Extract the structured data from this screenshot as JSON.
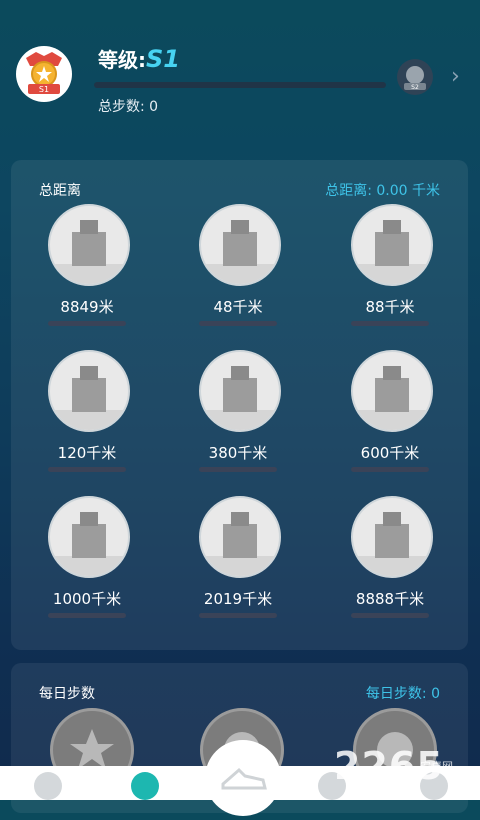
{
  "header": {
    "level_prefix": "等级:",
    "level_value": "S1",
    "steps_label": "总步数: 0",
    "badge_current_text": "S1",
    "badge_next_text": "S2",
    "progress_fraction": 0.0
  },
  "distance_card": {
    "title": "总距离",
    "total": "总距离: 0.00 千米",
    "items": [
      {
        "label": "8849米",
        "icon": "castle-icon"
      },
      {
        "label": "48千米",
        "icon": "skyline-icon"
      },
      {
        "label": "88千米",
        "icon": "skyscrapers-icon"
      },
      {
        "label": "120千米",
        "icon": "fortress-icon"
      },
      {
        "label": "380千米",
        "icon": "station-icon"
      },
      {
        "label": "600千米",
        "icon": "temple-icon"
      },
      {
        "label": "1000千米",
        "icon": "capitol-icon"
      },
      {
        "label": "2019千米",
        "icon": "church-icon"
      },
      {
        "label": "8888千米",
        "icon": "cityscape-icon"
      }
    ]
  },
  "steps_card": {
    "title": "每日步数",
    "total": "每日步数: 0"
  },
  "watermark": {
    "main": "2265",
    "sub": "安卓网"
  },
  "colors": {
    "accent": "#47d3f2",
    "teal": "#1db7b0"
  }
}
